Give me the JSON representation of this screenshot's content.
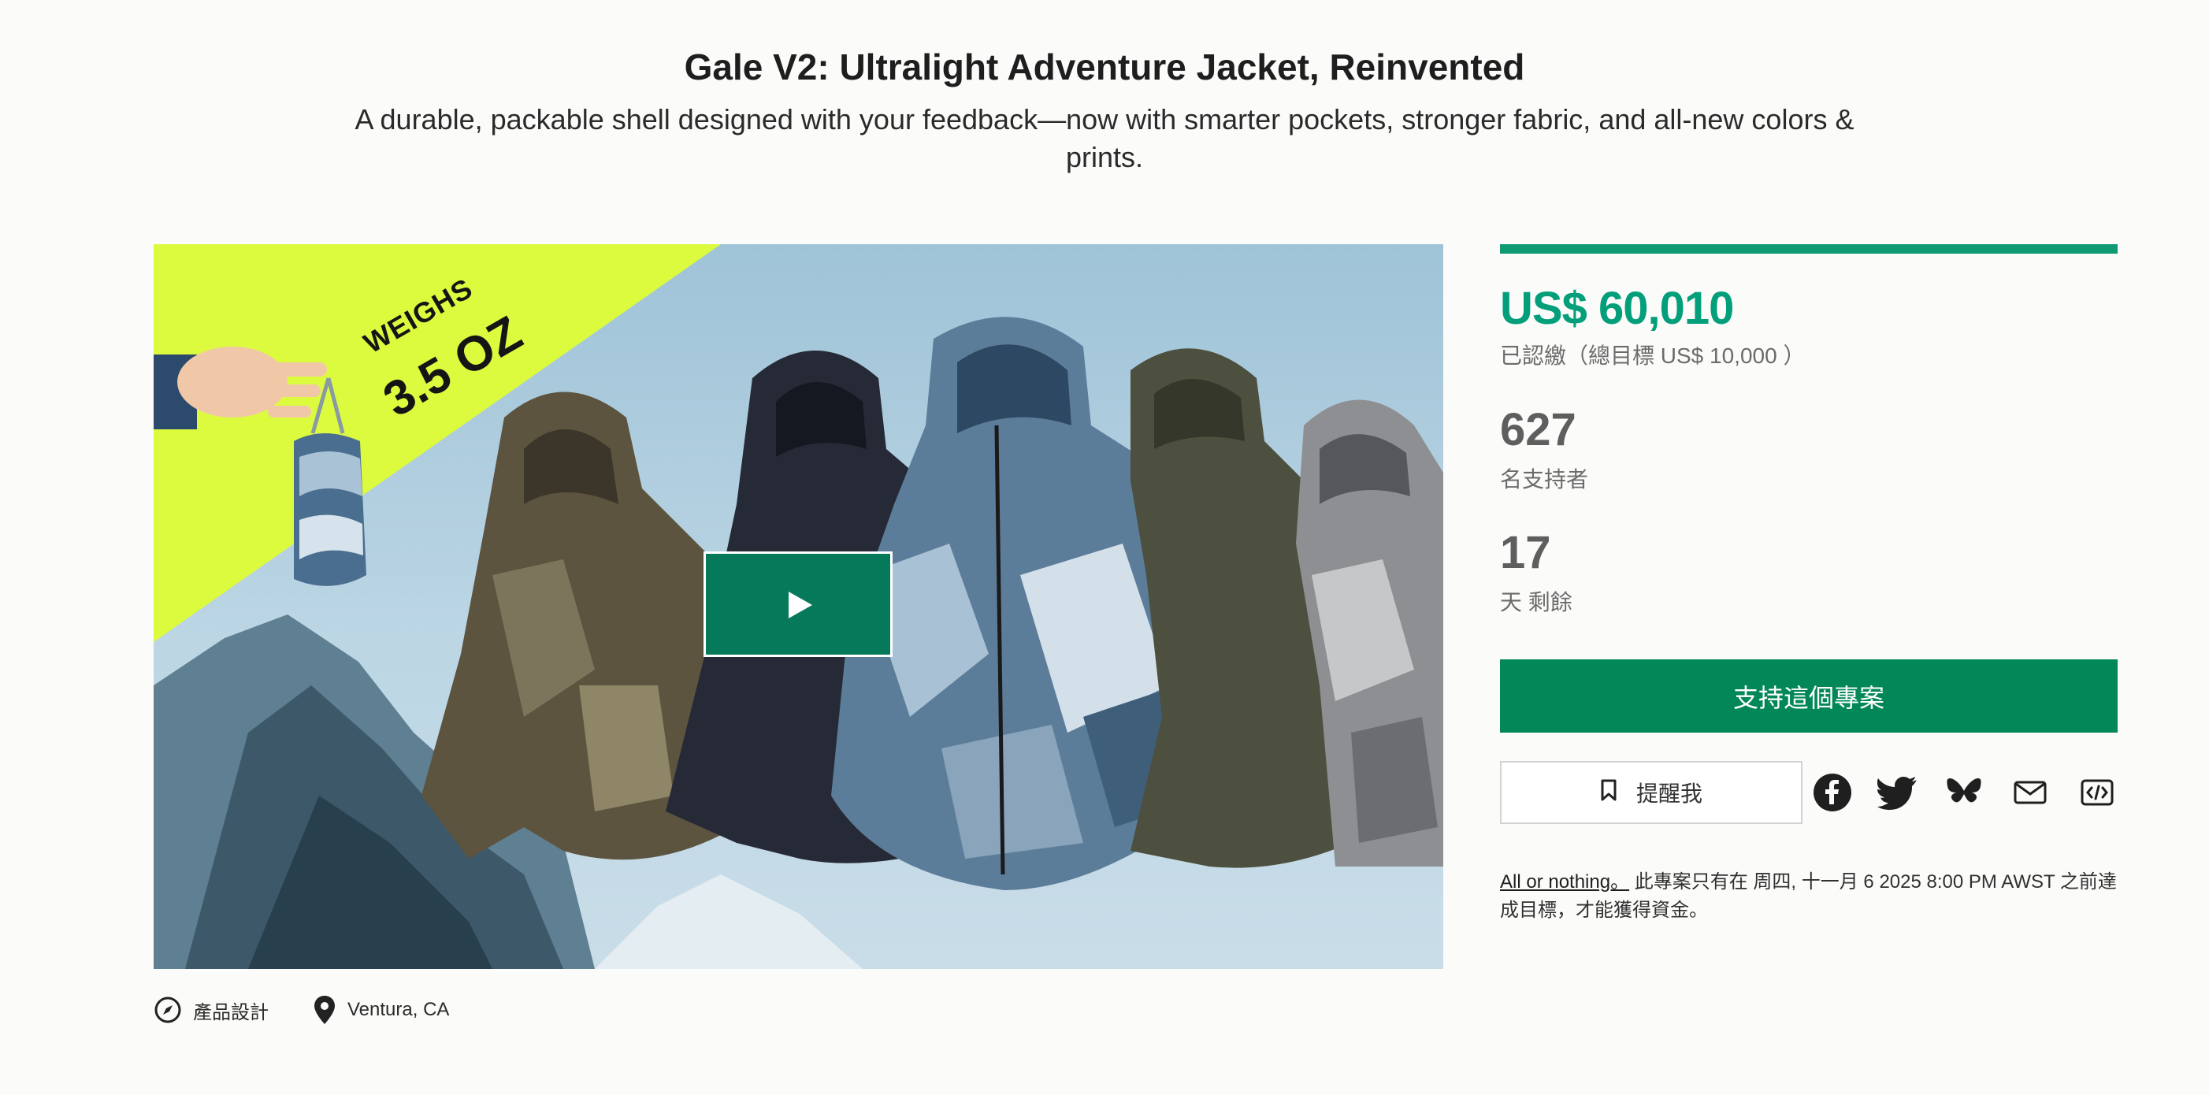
{
  "header": {
    "title": "Gale V2: Ultralight Adventure Jacket, Reinvented",
    "subtitle": "A durable, packable shell designed with your feedback—now with smarter pockets, stronger fabric, and all-new colors & prints."
  },
  "hero": {
    "weighs_label": "WEIGHS",
    "weight_value": "3.5 OZ",
    "play_icon": "play-icon"
  },
  "meta": {
    "category_icon": "compass-icon",
    "category": "產品設計",
    "location_icon": "location-pin-icon",
    "location": "Ventura, CA"
  },
  "campaign": {
    "pledged": "US$ 60,010",
    "goal_text": "已認繳（總目標 US$ 10,000 ）",
    "backers": "627",
    "backers_label": "名支持者",
    "days_left": "17",
    "days_label": "天 剩餘",
    "funded_fraction": 1.0,
    "back_button": "支持這個專案",
    "remind_button": "提醒我",
    "remind_icon": "bookmark-icon",
    "share_icons": [
      "facebook-icon",
      "twitter-icon",
      "bluesky-icon",
      "mail-icon",
      "embed-icon"
    ],
    "all_or_nothing": "All or nothing。",
    "funding_note": " 此專案只有在 周四, 十一月 6 2025 8:00 PM AWST 之前達成目標，才能獲得資金。"
  },
  "colors": {
    "accent_green": "#039f7a",
    "button_green": "#028858",
    "progress_green": "#0f9a73",
    "banner_yellow": "#dcfb3f"
  }
}
